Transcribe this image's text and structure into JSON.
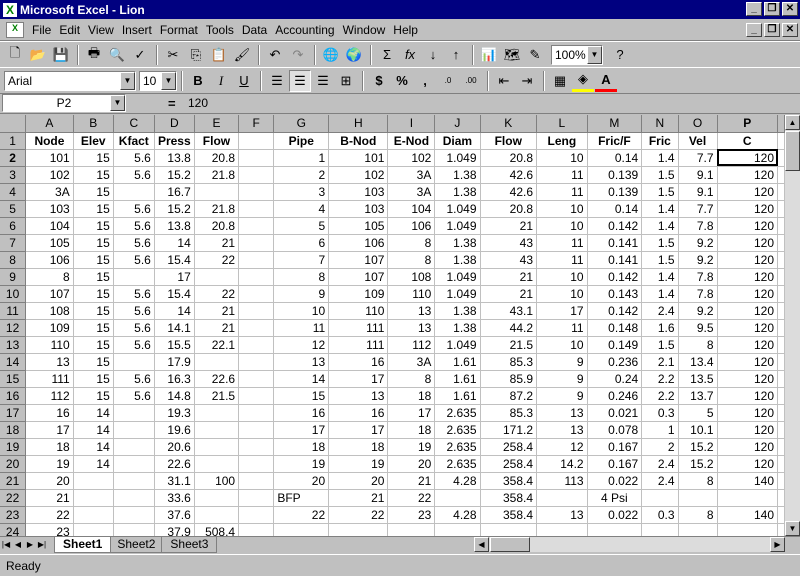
{
  "window": {
    "title": "Microsoft Excel - Lion",
    "min": "_",
    "restore": "❐",
    "close": "✕"
  },
  "menu": [
    "File",
    "Edit",
    "View",
    "Insert",
    "Format",
    "Tools",
    "Data",
    "Accounting",
    "Window",
    "Help"
  ],
  "toolbar": {
    "zoom": "100%",
    "font": "Arial",
    "size": "10"
  },
  "formula": {
    "cell": "P2",
    "eq": "=",
    "value": "120"
  },
  "columns": [
    "A",
    "B",
    "C",
    "D",
    "E",
    "F",
    "G",
    "H",
    "I",
    "J",
    "K",
    "L",
    "M",
    "N",
    "O",
    "P"
  ],
  "rows": [
    [
      "Node",
      "Elev",
      "Kfact",
      "Press",
      "Flow",
      "",
      "Pipe",
      "B-Nod",
      "E-Nod",
      "Diam",
      "Flow",
      "Leng",
      "Fric/F",
      "Fric",
      "Vel",
      "C"
    ],
    [
      "101",
      "15",
      "5.6",
      "13.8",
      "20.8",
      "",
      "1",
      "101",
      "102",
      "1.049",
      "20.8",
      "10",
      "0.14",
      "1.4",
      "7.7",
      "120"
    ],
    [
      "102",
      "15",
      "5.6",
      "15.2",
      "21.8",
      "",
      "2",
      "102",
      "3A",
      "1.38",
      "42.6",
      "11",
      "0.139",
      "1.5",
      "9.1",
      "120"
    ],
    [
      "3A",
      "15",
      "",
      "16.7",
      "",
      "",
      "3",
      "103",
      "3A",
      "1.38",
      "42.6",
      "11",
      "0.139",
      "1.5",
      "9.1",
      "120"
    ],
    [
      "103",
      "15",
      "5.6",
      "15.2",
      "21.8",
      "",
      "4",
      "103",
      "104",
      "1.049",
      "20.8",
      "10",
      "0.14",
      "1.4",
      "7.7",
      "120"
    ],
    [
      "104",
      "15",
      "5.6",
      "13.8",
      "20.8",
      "",
      "5",
      "105",
      "106",
      "1.049",
      "21",
      "10",
      "0.142",
      "1.4",
      "7.8",
      "120"
    ],
    [
      "105",
      "15",
      "5.6",
      "14",
      "21",
      "",
      "6",
      "106",
      "8",
      "1.38",
      "43",
      "11",
      "0.141",
      "1.5",
      "9.2",
      "120"
    ],
    [
      "106",
      "15",
      "5.6",
      "15.4",
      "22",
      "",
      "7",
      "107",
      "8",
      "1.38",
      "43",
      "11",
      "0.141",
      "1.5",
      "9.2",
      "120"
    ],
    [
      "8",
      "15",
      "",
      "17",
      "",
      "",
      "8",
      "107",
      "108",
      "1.049",
      "21",
      "10",
      "0.142",
      "1.4",
      "7.8",
      "120"
    ],
    [
      "107",
      "15",
      "5.6",
      "15.4",
      "22",
      "",
      "9",
      "109",
      "110",
      "1.049",
      "21",
      "10",
      "0.143",
      "1.4",
      "7.8",
      "120"
    ],
    [
      "108",
      "15",
      "5.6",
      "14",
      "21",
      "",
      "10",
      "110",
      "13",
      "1.38",
      "43.1",
      "17",
      "0.142",
      "2.4",
      "9.2",
      "120"
    ],
    [
      "109",
      "15",
      "5.6",
      "14.1",
      "21",
      "",
      "11",
      "111",
      "13",
      "1.38",
      "44.2",
      "11",
      "0.148",
      "1.6",
      "9.5",
      "120"
    ],
    [
      "110",
      "15",
      "5.6",
      "15.5",
      "22.1",
      "",
      "12",
      "111",
      "112",
      "1.049",
      "21.5",
      "10",
      "0.149",
      "1.5",
      "8",
      "120"
    ],
    [
      "13",
      "15",
      "",
      "17.9",
      "",
      "",
      "13",
      "16",
      "3A",
      "1.61",
      "85.3",
      "9",
      "0.236",
      "2.1",
      "13.4",
      "120"
    ],
    [
      "111",
      "15",
      "5.6",
      "16.3",
      "22.6",
      "",
      "14",
      "17",
      "8",
      "1.61",
      "85.9",
      "9",
      "0.24",
      "2.2",
      "13.5",
      "120"
    ],
    [
      "112",
      "15",
      "5.6",
      "14.8",
      "21.5",
      "",
      "15",
      "13",
      "18",
      "1.61",
      "87.2",
      "9",
      "0.246",
      "2.2",
      "13.7",
      "120"
    ],
    [
      "16",
      "14",
      "",
      "19.3",
      "",
      "",
      "16",
      "16",
      "17",
      "2.635",
      "85.3",
      "13",
      "0.021",
      "0.3",
      "5",
      "120"
    ],
    [
      "17",
      "14",
      "",
      "19.6",
      "",
      "",
      "17",
      "17",
      "18",
      "2.635",
      "171.2",
      "13",
      "0.078",
      "1",
      "10.1",
      "120"
    ],
    [
      "18",
      "14",
      "",
      "20.6",
      "",
      "",
      "18",
      "18",
      "19",
      "2.635",
      "258.4",
      "12",
      "0.167",
      "2",
      "15.2",
      "120"
    ],
    [
      "19",
      "14",
      "",
      "22.6",
      "",
      "",
      "19",
      "19",
      "20",
      "2.635",
      "258.4",
      "14.2",
      "0.167",
      "2.4",
      "15.2",
      "120"
    ],
    [
      "20",
      "",
      "",
      "31.1",
      "100",
      "",
      "20",
      "20",
      "21",
      "4.28",
      "358.4",
      "113",
      "0.022",
      "2.4",
      "8",
      "140"
    ],
    [
      "21",
      "",
      "",
      "33.6",
      "",
      "",
      "BFP",
      "21",
      "22",
      "",
      "358.4",
      "",
      "4  Psi",
      "",
      "",
      ""
    ],
    [
      "22",
      "",
      "",
      "37.6",
      "",
      "",
      "22",
      "22",
      "23",
      "4.28",
      "358.4",
      "13",
      "0.022",
      "0.3",
      "8",
      "140"
    ],
    [
      "23",
      "",
      "",
      "37.9",
      "508.4",
      "",
      "",
      "",
      "",
      "",
      "",
      "",
      "",
      "",
      "",
      ""
    ]
  ],
  "sheets": [
    "Sheet1",
    "Sheet2",
    "Sheet3"
  ],
  "status": "Ready"
}
